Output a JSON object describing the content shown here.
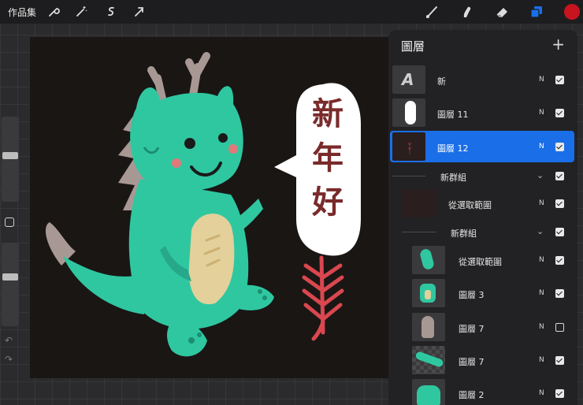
{
  "topbar": {
    "gallery_label": "作品集",
    "tools_left": [
      "wrench-icon",
      "magic-wand-icon",
      "selection-icon",
      "transform-arrow-icon"
    ],
    "tools_right": [
      "brush-icon",
      "smudge-icon",
      "eraser-icon",
      "layers-icon",
      "color-swatch"
    ],
    "active_color": "#c8141e",
    "accent": "#1a6fe8"
  },
  "artwork": {
    "greeting": [
      "新",
      "年",
      "好"
    ],
    "greeting_color": "#7a2a2a",
    "dragon_color": "#2fc7a0",
    "belly_color": "#e3d09a",
    "horn_color": "#a89894",
    "firecracker_color": "#d9474f"
  },
  "layers_panel": {
    "title": "圖層",
    "add_icon": "plus-icon",
    "layers": [
      {
        "name": "新",
        "blend": "N",
        "visible": true,
        "kind": "text"
      },
      {
        "name": "圖層 11",
        "blend": "N",
        "visible": true,
        "kind": "bubble"
      },
      {
        "name": "圖層 12",
        "blend": "N",
        "visible": true,
        "kind": "firecracker",
        "selected": true
      },
      {
        "name": "新群組",
        "blend": "",
        "visible": true,
        "kind": "group"
      },
      {
        "name": "從選取範圍",
        "blend": "N",
        "visible": true,
        "kind": "dark"
      },
      {
        "name": "新群組",
        "blend": "",
        "visible": true,
        "kind": "group"
      },
      {
        "name": "從選取範圍",
        "blend": "N",
        "visible": true,
        "kind": "teal"
      },
      {
        "name": "圖層 3",
        "blend": "N",
        "visible": true,
        "kind": "teal-body"
      },
      {
        "name": "圖層 7",
        "blend": "N",
        "visible": false,
        "kind": "spikes"
      },
      {
        "name": "圖層 7",
        "blend": "N",
        "visible": true,
        "kind": "tail"
      },
      {
        "name": "圖層 2",
        "blend": "N",
        "visible": true,
        "kind": "head"
      }
    ]
  }
}
